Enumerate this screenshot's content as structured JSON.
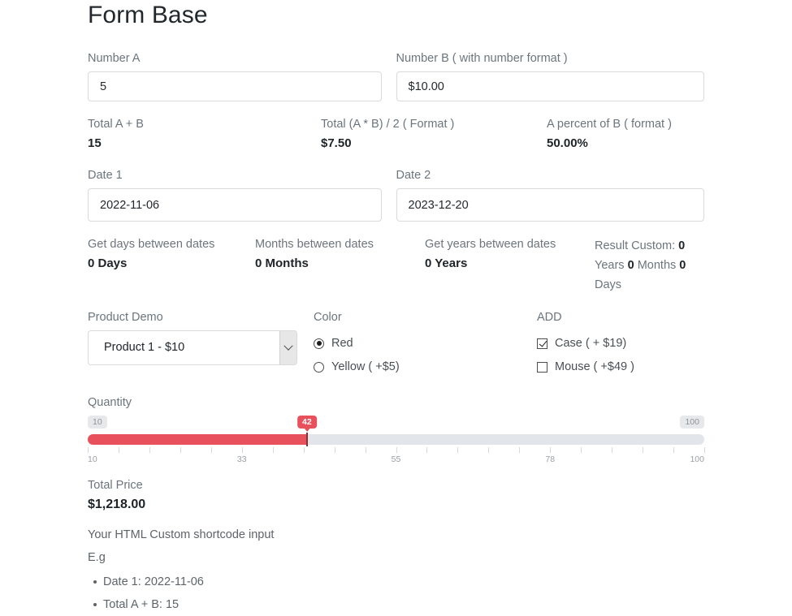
{
  "page": {
    "title": "Form Base"
  },
  "numbers": {
    "a": {
      "label": "Number A",
      "value": "5"
    },
    "b": {
      "label": "Number B ( with number format )",
      "value": "$10.00"
    }
  },
  "number_results": [
    {
      "label": "Total A + B",
      "value": "15"
    },
    {
      "label": "Total (A * B) / 2 ( Format )",
      "value": "$7.50"
    },
    {
      "label": "A percent of B ( format )",
      "value": "50.00%"
    }
  ],
  "dates": {
    "one": {
      "label": "Date 1",
      "value": "2022-11-06"
    },
    "two": {
      "label": "Date 2",
      "value": "2023-12-20"
    }
  },
  "date_results": [
    {
      "label": "Get days between dates",
      "value": "0 Days"
    },
    {
      "label": "Months between dates",
      "value": "0 Months"
    },
    {
      "label": "Get years between dates",
      "value": "0 Years"
    }
  ],
  "date_custom": {
    "prefix": "Result Custom:",
    "years_value": "0",
    "years_unit": "Years",
    "months_value": "0",
    "months_unit": "Months",
    "days_value": "0",
    "days_unit": "Days"
  },
  "product": {
    "label": "Product Demo",
    "selected": "Product 1 - $10",
    "dropdown_icon": "chevron-down-icon"
  },
  "color": {
    "label": "Color",
    "options": [
      {
        "label": "Red",
        "checked": true
      },
      {
        "label": "Yellow ( +$5)",
        "checked": false
      }
    ]
  },
  "add": {
    "label": "ADD",
    "options": [
      {
        "label": "Case ( + $19)",
        "checked": true
      },
      {
        "label": "Mouse ( +$49 )",
        "checked": false
      }
    ]
  },
  "quantity": {
    "label": "Quantity",
    "min": 10,
    "max": 100,
    "value": 42,
    "min_pill": "10",
    "max_pill": "100",
    "value_pill": "42",
    "accent_color": "#e8505b",
    "track_color": "#e2e5e9",
    "tick_labels": [
      "10",
      "33",
      "55",
      "78",
      "100"
    ]
  },
  "total_price": {
    "label": "Total Price",
    "value": "$1,218.00"
  },
  "shortcode": {
    "heading": "Your HTML Custom shortcode input",
    "eg": "E.g",
    "items": [
      "Date 1: 2022-11-06",
      "Total A + B: 15"
    ]
  }
}
